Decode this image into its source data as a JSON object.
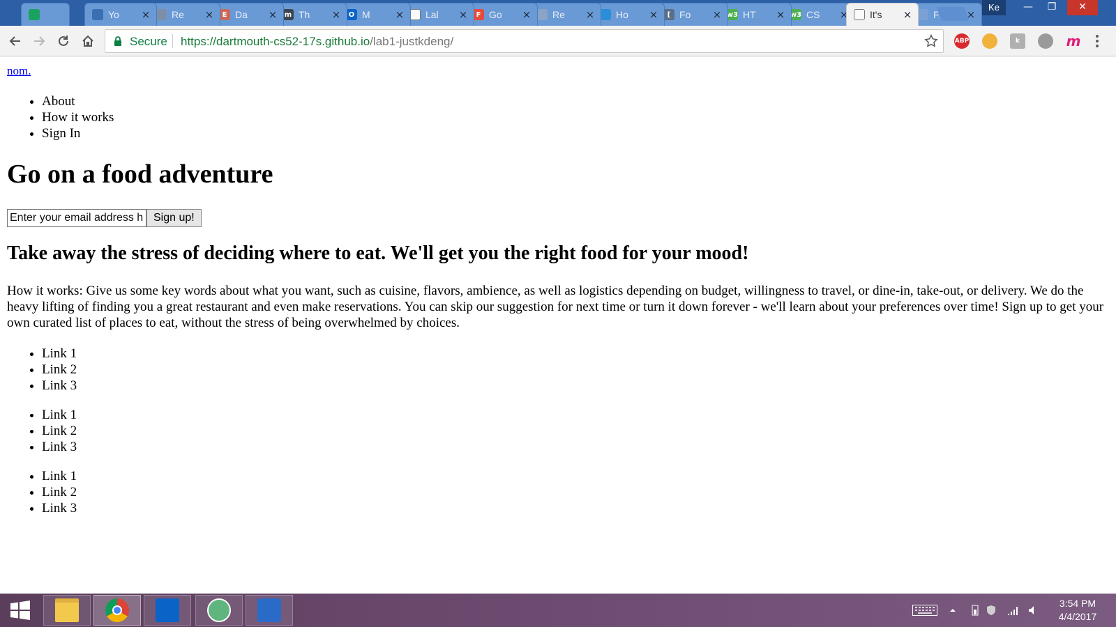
{
  "browser": {
    "tabs": [
      {
        "title": "",
        "favicon": "green-n-icon",
        "color": "#1aa260",
        "letter": ""
      },
      {
        "title": "Yo",
        "favicon": "wave-icon",
        "color": "#3a6fb4",
        "letter": ""
      },
      {
        "title": "Re",
        "favicon": "cube-icon",
        "color": "#7d8fa6",
        "letter": ""
      },
      {
        "title": "Da",
        "favicon": "e-badge-icon",
        "color": "#c86a5a",
        "letter": "E"
      },
      {
        "title": "Th",
        "favicon": "m-icon",
        "color": "#3b4550",
        "letter": "m"
      },
      {
        "title": "M",
        "favicon": "outlook-icon",
        "color": "#0a64c8",
        "letter": "O"
      },
      {
        "title": "Lal",
        "favicon": "page-icon",
        "color": "#ffffff",
        "letter": ""
      },
      {
        "title": "Go",
        "favicon": "f-badge-icon",
        "color": "#e64a3b",
        "letter": "F"
      },
      {
        "title": "Re",
        "favicon": "reddit-icon",
        "color": "#8ba3c4",
        "letter": ""
      },
      {
        "title": "Ho",
        "favicon": "edge-icon",
        "color": "#2b8ed8",
        "letter": ""
      },
      {
        "title": "Fo",
        "favicon": "bracket-icon",
        "color": "#5a6e86",
        "letter": "["
      },
      {
        "title": "HT",
        "favicon": "w3-icon",
        "color": "#4caf50",
        "letter": "w3"
      },
      {
        "title": "CS",
        "favicon": "w3-icon",
        "color": "#4caf50",
        "letter": "w3"
      },
      {
        "title": "It's",
        "favicon": "page-icon",
        "color": "#ffffff",
        "letter": "",
        "active": true
      },
      {
        "title": "Fle",
        "favicon": "spinner-icon",
        "color": "#7aa0d4",
        "letter": ""
      }
    ],
    "profile_label": "Ke",
    "secure_label": "Secure",
    "url_base": "https://dartmouth-cs52-17s.github.io",
    "url_path": "/lab1-justkdeng/",
    "extensions": [
      {
        "name": "adblock-icon",
        "label": "ABP",
        "color": "#d9282e"
      },
      {
        "name": "tampermonkey-icon",
        "label": "",
        "color": "#f0b23a"
      },
      {
        "name": "k-extension-icon",
        "label": "k",
        "color": "#b0b0b0"
      },
      {
        "name": "puzzle-icon",
        "label": "",
        "color": "#9a9a9a"
      },
      {
        "name": "m-extension-icon",
        "label": "m",
        "color": "#e0207a"
      }
    ]
  },
  "site": {
    "brand": "nom.",
    "nav": [
      "About",
      "How it works",
      "Sign In"
    ],
    "headline": "Go on a food adventure",
    "signup": {
      "placeholder": "Enter your email address here",
      "button": "Sign up!"
    },
    "tagline": "Take away the stress of deciding where to eat. We'll get you the right food for your mood!",
    "how_it_works": "How it works: Give us some key words about what you want, such as cuisine, flavors, ambience, as well as logistics depending on budget, willingness to travel, or dine-in, take-out, or delivery. We do the heavy lifting of finding you a great restaurant and even make reservations. You can skip our suggestion for next time or turn it down forever - we'll learn about your preferences over time! Sign up to get your own curated list of places to eat, without the stress of being overwhelmed by choices.",
    "link_lists": [
      [
        "Link 1",
        "Link 2",
        "Link 3"
      ],
      [
        "Link 1",
        "Link 2",
        "Link 3"
      ],
      [
        "Link 1",
        "Link 2",
        "Link 3"
      ]
    ]
  },
  "taskbar": {
    "apps": [
      {
        "name": "file-explorer-icon",
        "color": "#f2c94c"
      },
      {
        "name": "chrome-icon",
        "color": "#4285f4",
        "active": true
      },
      {
        "name": "outlook-app-icon",
        "color": "#0a64c8"
      },
      {
        "name": "atom-icon",
        "color": "#5fb57d"
      },
      {
        "name": "powershell-icon",
        "color": "#2a6bc8"
      }
    ],
    "time": "3:54 PM",
    "date": "4/4/2017"
  }
}
